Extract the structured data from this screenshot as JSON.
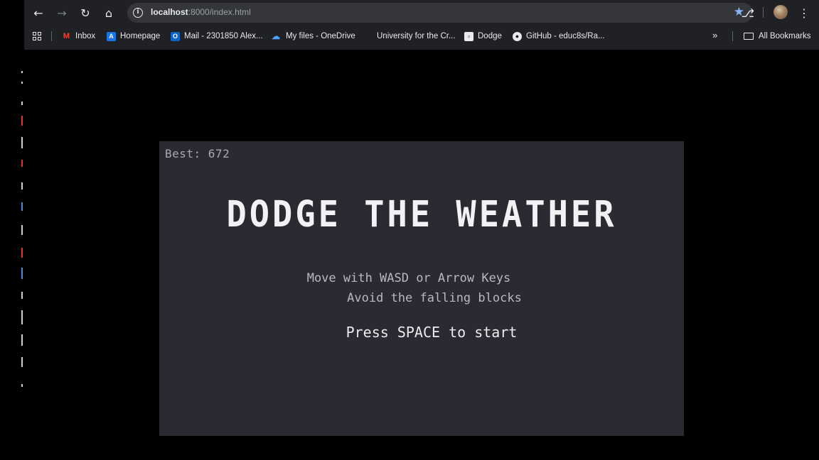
{
  "browser": {
    "url_host": "localhost",
    "url_rest": ":8000/index.html",
    "bookmarks": [
      {
        "label": "Inbox",
        "icon": "gmail-icon"
      },
      {
        "label": "Homepage",
        "icon": "homepage-icon"
      },
      {
        "label": "Mail - 2301850 Alex...",
        "icon": "outlook-icon"
      },
      {
        "label": "My files - OneDrive",
        "icon": "onedrive-icon"
      },
      {
        "label": "University for the Cr...",
        "icon": "none"
      },
      {
        "label": "Dodge",
        "icon": "page-icon"
      },
      {
        "label": "GitHub - educ8s/Ra...",
        "icon": "github-icon"
      }
    ],
    "all_bookmarks_label": "All Bookmarks",
    "accent_star": "#8ab4f8"
  },
  "game": {
    "best_label": "Best: 672",
    "title": "DODGE THE WEATHER",
    "instruction_1": "Move with WASD or Arrow Keys",
    "instruction_2": "Avoid the falling blocks",
    "start_prompt": "Press SPACE to start",
    "background": "#2b2a33"
  }
}
